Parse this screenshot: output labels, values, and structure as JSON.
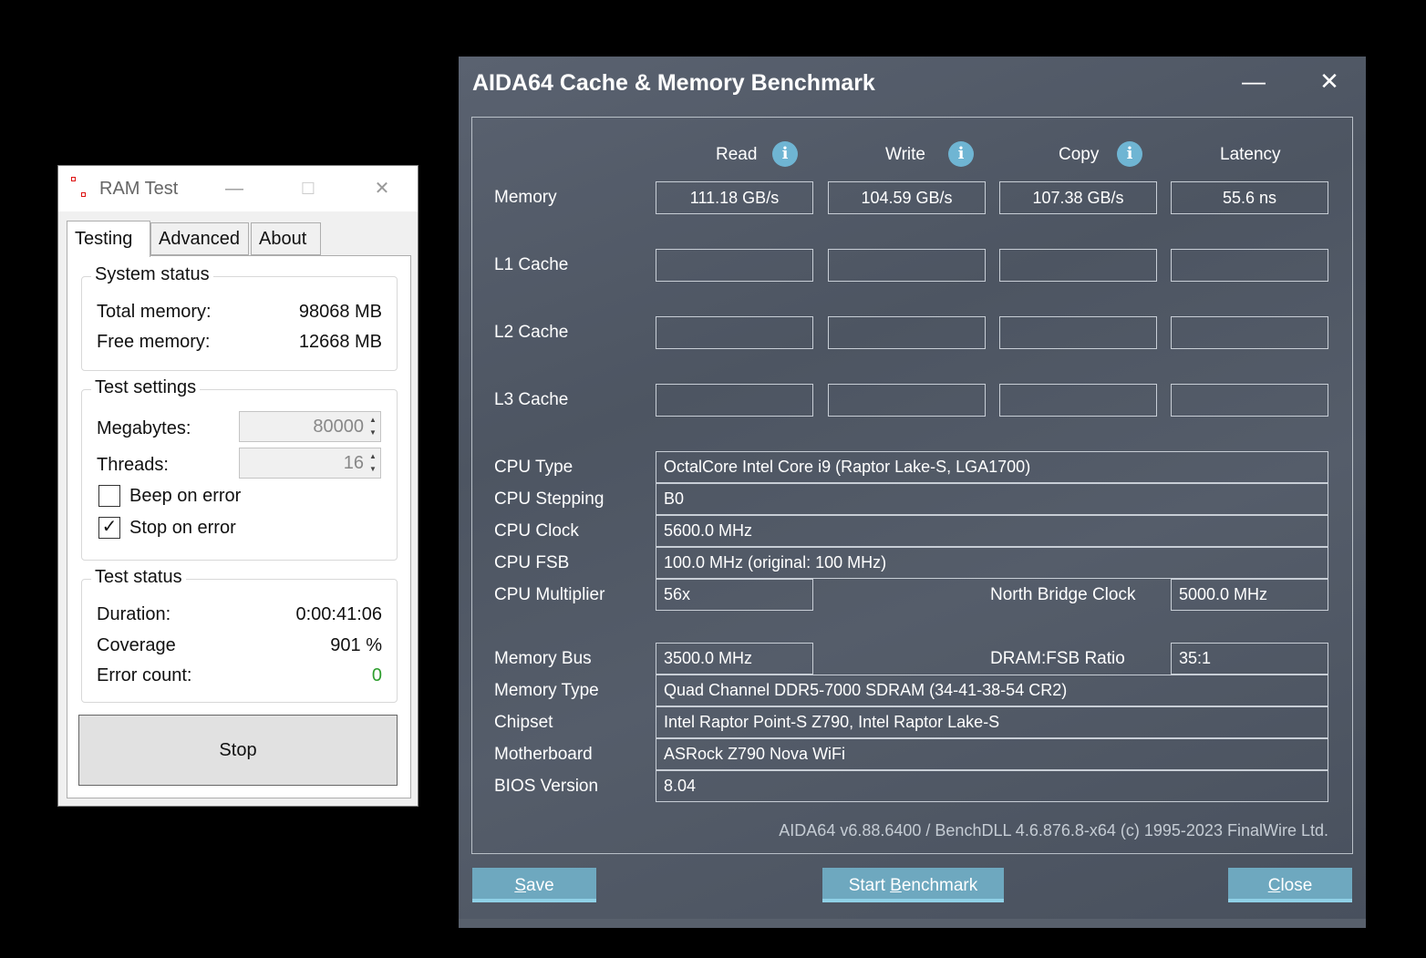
{
  "ramtest": {
    "title": "RAM Test",
    "window_controls": {
      "minimize": "—",
      "maximize": "☐",
      "close": "✕"
    },
    "tabs": [
      "Testing",
      "Advanced",
      "About"
    ],
    "system_status": {
      "title": "System status",
      "total_label": "Total memory:",
      "total_value": "98068 MB",
      "free_label": "Free memory:",
      "free_value": "12668 MB"
    },
    "test_settings": {
      "title": "Test settings",
      "megabytes_label": "Megabytes:",
      "megabytes_value": "80000",
      "threads_label": "Threads:",
      "threads_value": "16",
      "beep_label": "Beep on error",
      "beep_checked": false,
      "stop_label": "Stop on error",
      "stop_checked": true,
      "check_mark": "✓"
    },
    "test_status": {
      "title": "Test status",
      "duration_label": "Duration:",
      "duration_value": "0:00:41:06",
      "coverage_label": "Coverage",
      "coverage_value": "901 %",
      "errors_label": "Error count:",
      "errors_value": "0",
      "errors_color": "#2e9e2e"
    },
    "stop_button": "Stop"
  },
  "aida": {
    "title": "AIDA64 Cache & Memory Benchmark",
    "window_controls": {
      "minimize": "—",
      "close": "✕"
    },
    "columns": [
      "Read",
      "Write",
      "Copy",
      "Latency"
    ],
    "info_glyph": "i",
    "rows": [
      {
        "label": "Memory",
        "values": [
          "111.18 GB/s",
          "104.59 GB/s",
          "107.38 GB/s",
          "55.6 ns"
        ]
      },
      {
        "label": "L1 Cache",
        "values": [
          "",
          "",
          "",
          ""
        ]
      },
      {
        "label": "L2 Cache",
        "values": [
          "",
          "",
          "",
          ""
        ]
      },
      {
        "label": "L3 Cache",
        "values": [
          "",
          "",
          "",
          ""
        ]
      }
    ],
    "info": {
      "cpu_type_label": "CPU Type",
      "cpu_type": "OctalCore Intel Core i9  (Raptor Lake-S, LGA1700)",
      "cpu_stepping_label": "CPU Stepping",
      "cpu_stepping": "B0",
      "cpu_clock_label": "CPU Clock",
      "cpu_clock": "5600.0 MHz",
      "cpu_fsb_label": "CPU FSB",
      "cpu_fsb": "100.0 MHz  (original: 100 MHz)",
      "cpu_mult_label": "CPU Multiplier",
      "cpu_mult": "56x",
      "nb_clock_label": "North Bridge Clock",
      "nb_clock": "5000.0 MHz",
      "mem_bus_label": "Memory Bus",
      "mem_bus": "3500.0 MHz",
      "dram_ratio_label": "DRAM:FSB Ratio",
      "dram_ratio": "35:1",
      "mem_type_label": "Memory Type",
      "mem_type": "Quad Channel DDR5-7000 SDRAM  (34-41-38-54 CR2)",
      "chipset_label": "Chipset",
      "chipset": "Intel Raptor Point-S Z790, Intel Raptor Lake-S",
      "mobo_label": "Motherboard",
      "mobo": "ASRock Z790 Nova WiFi",
      "bios_label": "BIOS Version",
      "bios": "8.04"
    },
    "footer": "AIDA64 v6.88.6400 / BenchDLL 4.6.876.8-x64  (c) 1995-2023 FinalWire Ltd.",
    "buttons": {
      "save_u": "S",
      "save_rest": "ave",
      "start_a": "Start ",
      "start_u": "B",
      "start_b": "enchmark",
      "close_u": "C",
      "close_rest": "lose"
    },
    "accent_color": "#6ea8bf"
  }
}
